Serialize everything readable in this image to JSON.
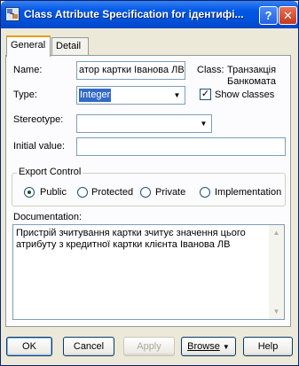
{
  "window": {
    "title": "Class Attribute Specification for ідентифі...",
    "help_glyph": "?",
    "close_glyph": "✕"
  },
  "tabs": [
    {
      "label": "General"
    },
    {
      "label": "Detail"
    }
  ],
  "fields": {
    "name_label": "Name:",
    "name_value": "атор картки Іванова ЛВ",
    "class_label": "Class:",
    "class_value_line1": "Транзакція",
    "class_value_line2": "Банкомата",
    "type_label": "Type:",
    "type_value": "Integer",
    "show_classes_label": "Show classes",
    "show_classes_checked": true,
    "stereotype_label": "Stereotype:",
    "stereotype_value": "",
    "initial_value_label": "Initial value:",
    "initial_value": ""
  },
  "export_control": {
    "legend": "Export Control",
    "options": [
      {
        "label": "Public",
        "selected": true
      },
      {
        "label": "Protected",
        "selected": false
      },
      {
        "label": "Private",
        "selected": false
      },
      {
        "label": "Implementation",
        "selected": false
      }
    ]
  },
  "documentation": {
    "label": "Documentation:",
    "text": "Пристрій зчитування картки зчитує значення цього атрибуту з кредитної картки клієнта Іванова ЛВ"
  },
  "buttons": {
    "ok": "OK",
    "cancel": "Cancel",
    "apply": "Apply",
    "browse": "Browse",
    "browse_arrow": "▼",
    "help": "Help"
  }
}
